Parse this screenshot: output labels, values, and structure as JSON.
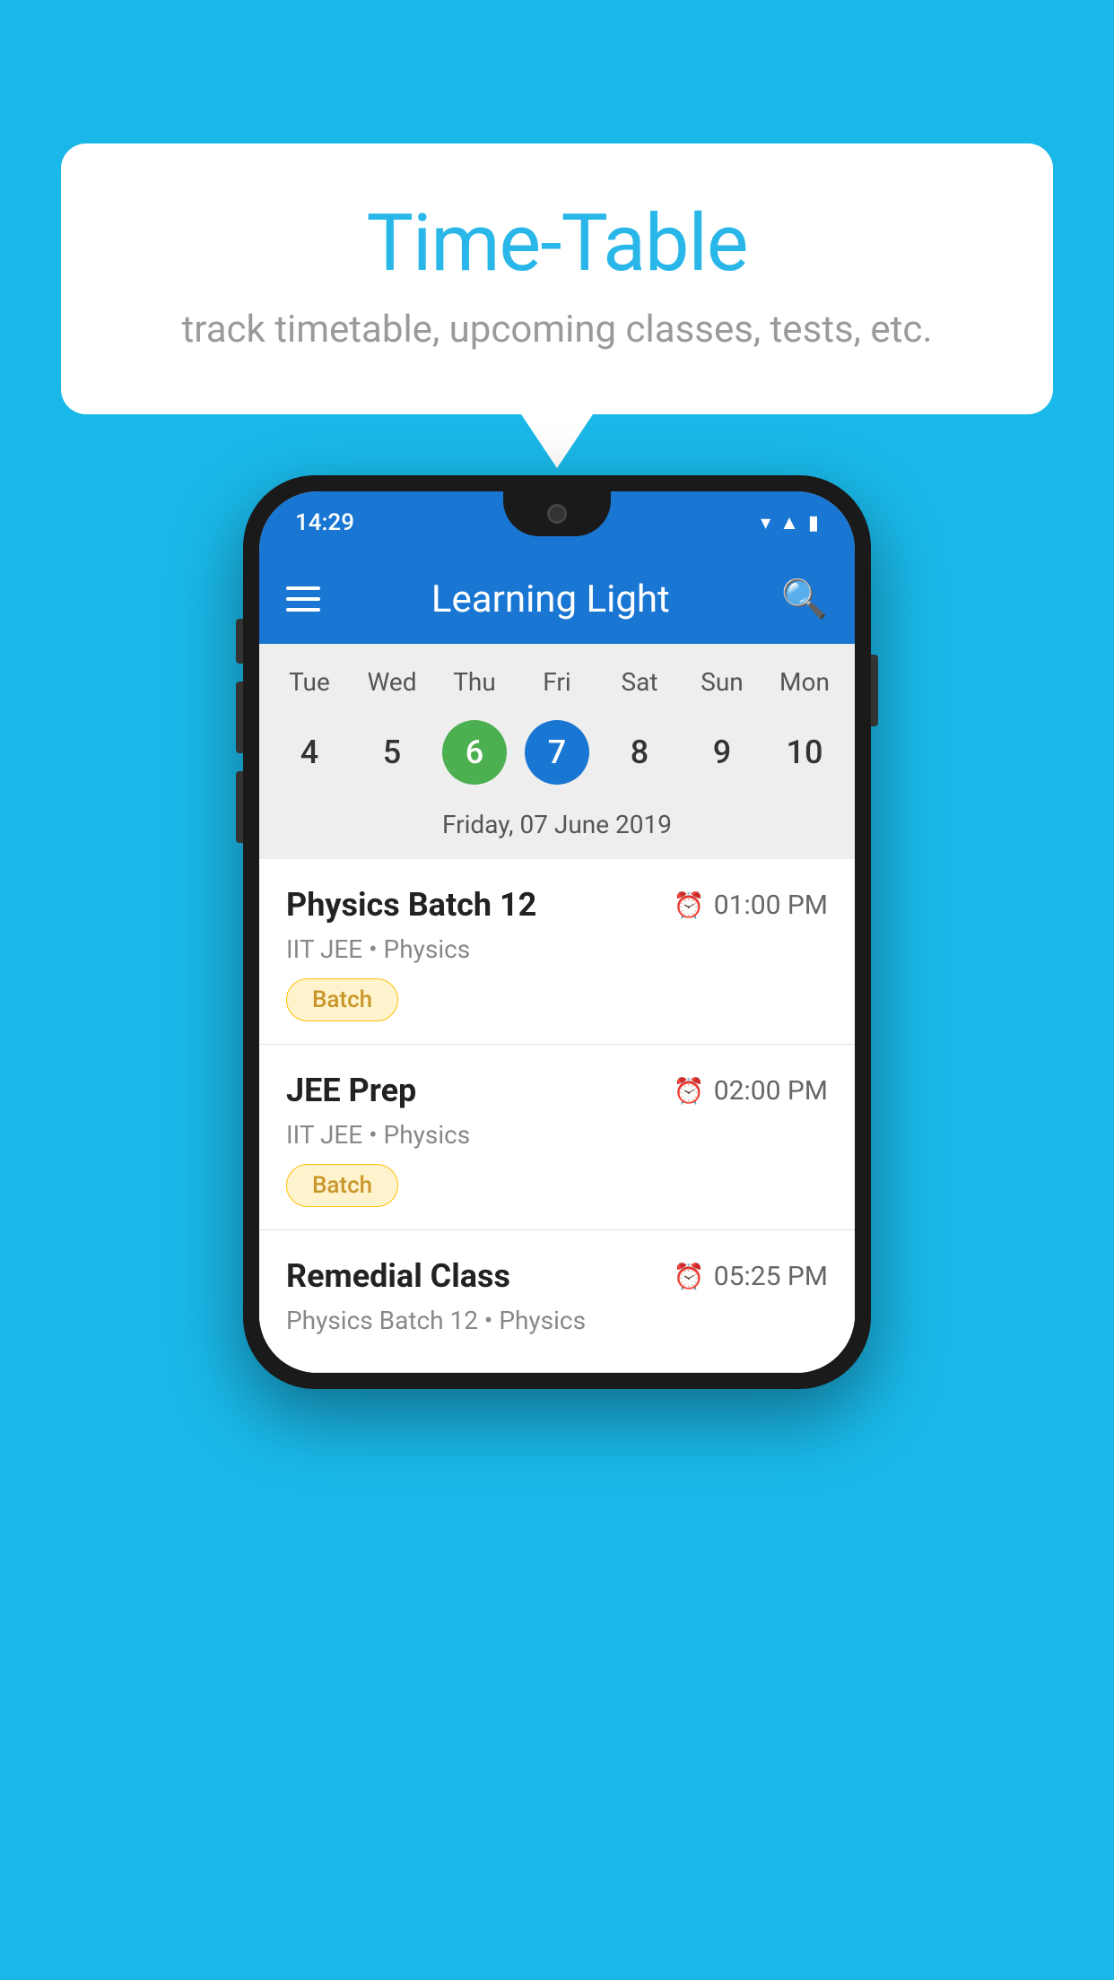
{
  "background_color": "#1ab8e8",
  "speech_bubble": {
    "title": "Time-Table",
    "subtitle": "track timetable, upcoming classes, tests, etc."
  },
  "phone": {
    "status_bar": {
      "time": "14:29"
    },
    "app_bar": {
      "title": "Learning Light"
    },
    "calendar": {
      "days": [
        {
          "label": "Tue",
          "number": "4"
        },
        {
          "label": "Wed",
          "number": "5"
        },
        {
          "label": "Thu",
          "number": "6",
          "state": "today"
        },
        {
          "label": "Fri",
          "number": "7",
          "state": "selected"
        },
        {
          "label": "Sat",
          "number": "8"
        },
        {
          "label": "Sun",
          "number": "9"
        },
        {
          "label": "Mon",
          "number": "10"
        }
      ],
      "selected_date_label": "Friday, 07 June 2019"
    },
    "schedule_items": [
      {
        "title": "Physics Batch 12",
        "time": "01:00 PM",
        "subtitle": "IIT JEE • Physics",
        "badge": "Batch"
      },
      {
        "title": "JEE Prep",
        "time": "02:00 PM",
        "subtitle": "IIT JEE • Physics",
        "badge": "Batch"
      },
      {
        "title": "Remedial Class",
        "time": "05:25 PM",
        "subtitle": "Physics Batch 12 • Physics",
        "badge": null
      }
    ]
  }
}
